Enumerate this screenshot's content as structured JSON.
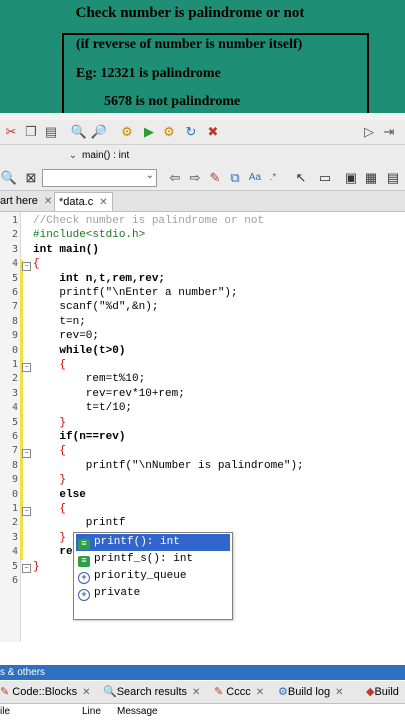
{
  "banner": {
    "title": "Check number is palindrome or not",
    "line1": "(if reverse of number is number itself)",
    "line2": "Eg: 12321 is palindrome",
    "line3": "5678 is not palindrome"
  },
  "toolbar": {
    "function_scope": "main() : int"
  },
  "tabs": {
    "start_here": "art here",
    "data_c": "*data.c"
  },
  "editor": {
    "line_numbers": [
      "1",
      "2",
      "3",
      "4",
      "5",
      "6",
      "7",
      "8",
      "9",
      "0",
      "1",
      "2",
      "3",
      "4",
      "5",
      "6",
      "7",
      "8",
      "9",
      "0",
      "1",
      "2",
      "3",
      "4",
      "5",
      "6"
    ],
    "lines": [
      {
        "text": "//Check number is palindrome or not",
        "cls": "c-comment"
      },
      {
        "text": "#include<stdio.h>",
        "cls": "c-prep"
      },
      {
        "text": "int main()",
        "cls": "c-kw"
      },
      {
        "text": "{",
        "cls": "c-op"
      },
      {
        "text": "    int n,t,rem,rev;",
        "cls": "c-kw"
      },
      {
        "text": "    printf(\"\\nEnter a number\");",
        "cls": ""
      },
      {
        "text": "    scanf(\"%d\",&n);",
        "cls": ""
      },
      {
        "text": "    t=n;",
        "cls": ""
      },
      {
        "text": "    rev=0;",
        "cls": ""
      },
      {
        "text": "    while(t>0)",
        "cls": "c-kw"
      },
      {
        "text": "    {",
        "cls": "c-op"
      },
      {
        "text": "        rem=t%10;",
        "cls": ""
      },
      {
        "text": "        rev=rev*10+rem;",
        "cls": ""
      },
      {
        "text": "        t=t/10;",
        "cls": ""
      },
      {
        "text": "    }",
        "cls": "c-op"
      },
      {
        "text": "    if(n==rev)",
        "cls": "c-kw"
      },
      {
        "text": "    {",
        "cls": "c-op"
      },
      {
        "text": "        printf(\"\\nNumber is palindrome\");",
        "cls": ""
      },
      {
        "text": "    }",
        "cls": "c-op"
      },
      {
        "text": "    else",
        "cls": "c-kw"
      },
      {
        "text": "    {",
        "cls": "c-op"
      },
      {
        "text": "        printf",
        "cls": ""
      },
      {
        "text": "    }",
        "cls": "c-op"
      },
      {
        "text": "    re",
        "cls": "c-kw"
      },
      {
        "text": "}",
        "cls": "c-op"
      },
      {
        "text": "",
        "cls": ""
      }
    ]
  },
  "autocomplete": {
    "items": [
      {
        "label": "printf(): int",
        "kind": "function"
      },
      {
        "label": "printf_s(): int",
        "kind": "function"
      },
      {
        "label": "priority_queue",
        "kind": "type"
      },
      {
        "label": "private",
        "kind": "type"
      }
    ]
  },
  "bottom": {
    "strip": "s & others",
    "tabs": [
      "Code::Blocks",
      "Search results",
      "Cccc",
      "Build log",
      "Build"
    ],
    "log_columns": [
      "ile",
      "Line",
      "Message"
    ]
  },
  "colors": {
    "banner_bg": "#1e8f74",
    "selection": "#3366cc"
  }
}
